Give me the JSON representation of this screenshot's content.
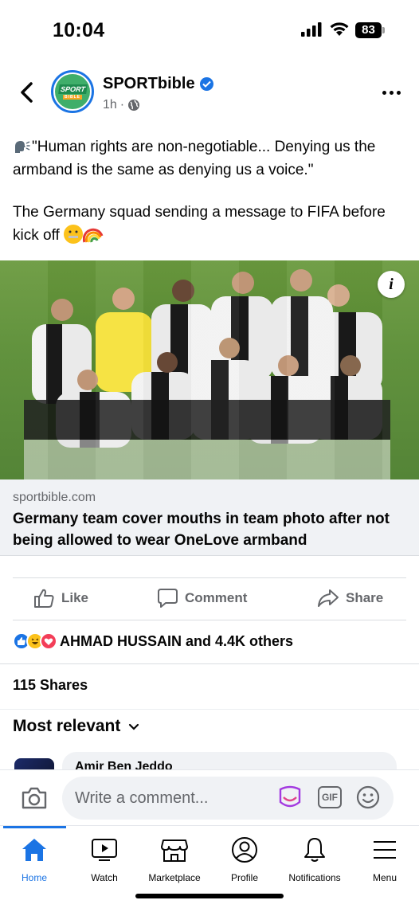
{
  "status_bar": {
    "time": "10:04",
    "battery": "83",
    "icons": [
      "signal-icon",
      "wifi-icon",
      "battery-icon"
    ]
  },
  "post": {
    "page_name": "SPORTbible",
    "avatar_text_top": "SPORT",
    "avatar_text_bottom": "BIBLE",
    "time_ago": "1h",
    "visibility_icon": "globe-icon",
    "verified": true,
    "text_line1": "\"Human rights are non-negotiable... Denying us the armband is the same as denying us a voice.\"",
    "text_line2": "The Germany squad sending a message to FIFA before kick off",
    "image_alt": "Germany national team lining up for a team photo, players covering their mouths with their hands",
    "link": {
      "domain": "sportbible.com",
      "title": "Germany team cover mouths in team photo after not being allowed to wear OneLove armband"
    }
  },
  "actions": {
    "like": "Like",
    "comment": "Comment",
    "share": "Share"
  },
  "reactions": {
    "text": "AHMAD HUSSAIN and 4.4K others",
    "icons": [
      "like-icon",
      "haha-icon",
      "love-icon"
    ]
  },
  "shares": "115 Shares",
  "sort_label": "Most relevant",
  "comment_preview": {
    "author": "Amir Ben Jeddo"
  },
  "composer": {
    "placeholder": "Write a comment...",
    "gif": "GIF"
  },
  "nav": {
    "home": "Home",
    "watch": "Watch",
    "marketplace": "Marketplace",
    "profile": "Profile",
    "notifications": "Notifications",
    "menu": "Menu"
  },
  "colors": {
    "accent": "#1b74e4",
    "secondary_text": "#65676b",
    "surface": "#f0f2f5"
  }
}
